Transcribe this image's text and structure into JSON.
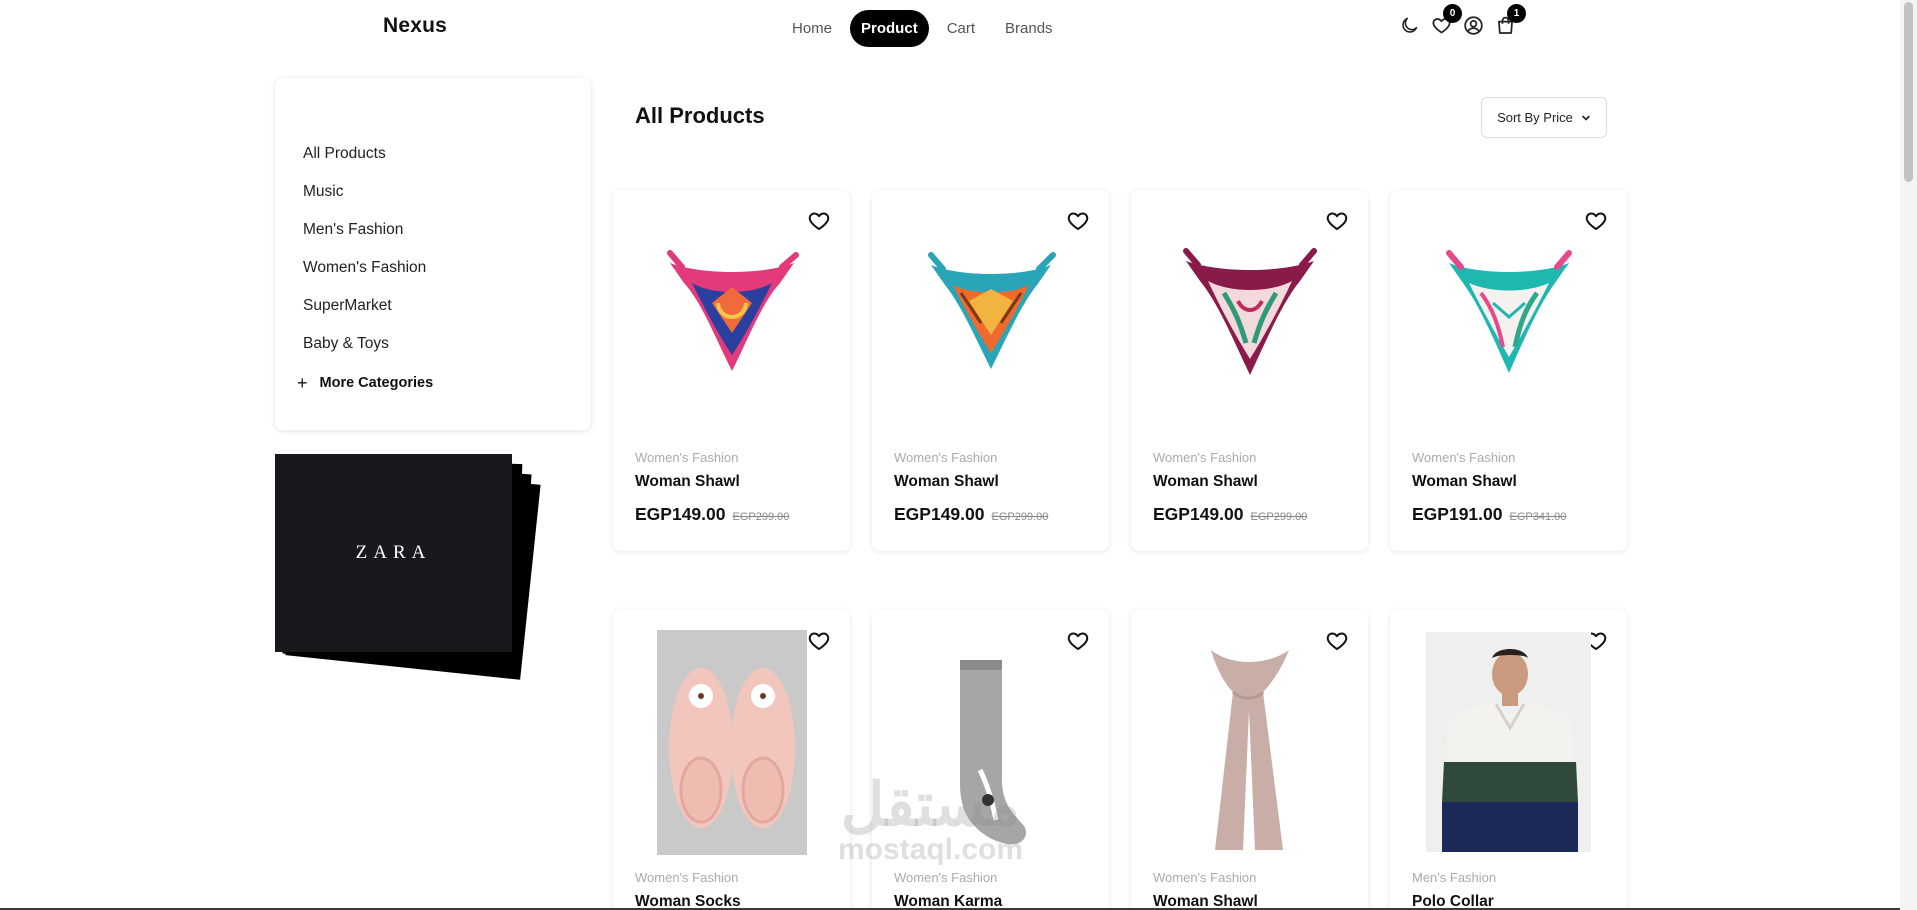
{
  "nav": {
    "brand": "Nexus",
    "links": [
      "Home",
      "Product",
      "Cart",
      "Brands"
    ],
    "active": "Product",
    "wishlist_count": "0",
    "cart_count": "1",
    "icons": [
      "moon-icon",
      "heart-icon",
      "user-icon",
      "shopping-bag-icon"
    ]
  },
  "sidebar": {
    "categories": [
      "All Products",
      "Music",
      "Men's Fashion",
      "Women's Fashion",
      "SuperMarket",
      "Baby & Toys"
    ],
    "more_label": "More Categories",
    "more_icon": "+"
  },
  "ad": {
    "brand": "ZARA"
  },
  "main": {
    "title": "All Products",
    "sort_label": "Sort By Price"
  },
  "products": [
    {
      "category": "Women's Fashion",
      "name": "Woman Shawl",
      "price": "EGP149.00",
      "old_price": "EGP299.00",
      "image": "scarf-icon"
    },
    {
      "category": "Women's Fashion",
      "name": "Woman Shawl",
      "price": "EGP149.00",
      "old_price": "EGP299.00",
      "image": "scarf-icon"
    },
    {
      "category": "Women's Fashion",
      "name": "Woman Shawl",
      "price": "EGP149.00",
      "old_price": "EGP299.00",
      "image": "scarf-icon"
    },
    {
      "category": "Women's Fashion",
      "name": "Woman Shawl",
      "price": "EGP191.00",
      "old_price": "EGP341.00",
      "image": "scarf-icon"
    },
    {
      "category": "Women's Fashion",
      "name": "Woman Socks",
      "price": "",
      "old_price": "",
      "image": "slippers-icon"
    },
    {
      "category": "Women's Fashion",
      "name": "Woman Karma",
      "price": "",
      "old_price": "",
      "image": "sock-icon"
    },
    {
      "category": "Women's Fashion",
      "name": "Woman Shawl",
      "price": "",
      "old_price": "",
      "image": "long-scarf-icon"
    },
    {
      "category": "Men's Fashion",
      "name": "Polo Collar",
      "price": "",
      "old_price": "",
      "image": "polo-shirt-icon"
    }
  ],
  "watermark": {
    "arabic": "مستقل",
    "latin": "mostaql.com"
  },
  "colors": {
    "accent": "#000000",
    "muted": "#aaaaaa",
    "ad_bg": "#1a181d"
  }
}
